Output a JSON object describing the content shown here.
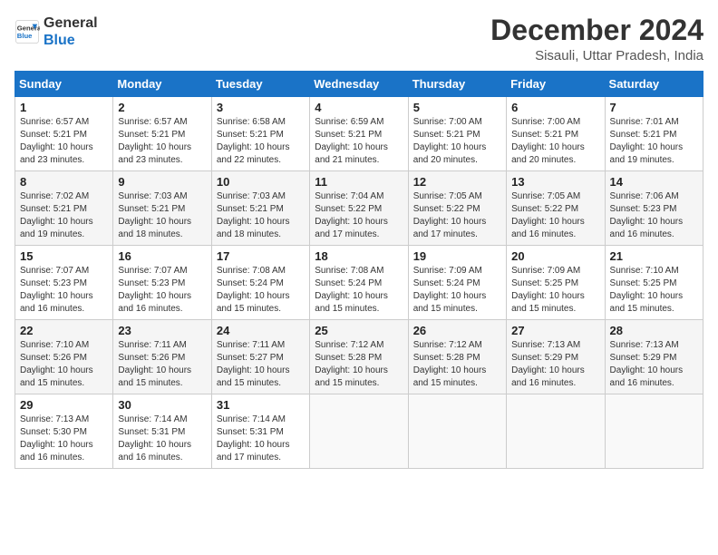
{
  "header": {
    "logo_line1": "General",
    "logo_line2": "Blue",
    "title": "December 2024",
    "subtitle": "Sisauli, Uttar Pradesh, India"
  },
  "weekdays": [
    "Sunday",
    "Monday",
    "Tuesday",
    "Wednesday",
    "Thursday",
    "Friday",
    "Saturday"
  ],
  "weeks": [
    [
      {
        "day": "1",
        "info": "Sunrise: 6:57 AM\nSunset: 5:21 PM\nDaylight: 10 hours\nand 23 minutes."
      },
      {
        "day": "2",
        "info": "Sunrise: 6:57 AM\nSunset: 5:21 PM\nDaylight: 10 hours\nand 23 minutes."
      },
      {
        "day": "3",
        "info": "Sunrise: 6:58 AM\nSunset: 5:21 PM\nDaylight: 10 hours\nand 22 minutes."
      },
      {
        "day": "4",
        "info": "Sunrise: 6:59 AM\nSunset: 5:21 PM\nDaylight: 10 hours\nand 21 minutes."
      },
      {
        "day": "5",
        "info": "Sunrise: 7:00 AM\nSunset: 5:21 PM\nDaylight: 10 hours\nand 20 minutes."
      },
      {
        "day": "6",
        "info": "Sunrise: 7:00 AM\nSunset: 5:21 PM\nDaylight: 10 hours\nand 20 minutes."
      },
      {
        "day": "7",
        "info": "Sunrise: 7:01 AM\nSunset: 5:21 PM\nDaylight: 10 hours\nand 19 minutes."
      }
    ],
    [
      {
        "day": "8",
        "info": "Sunrise: 7:02 AM\nSunset: 5:21 PM\nDaylight: 10 hours\nand 19 minutes."
      },
      {
        "day": "9",
        "info": "Sunrise: 7:03 AM\nSunset: 5:21 PM\nDaylight: 10 hours\nand 18 minutes."
      },
      {
        "day": "10",
        "info": "Sunrise: 7:03 AM\nSunset: 5:21 PM\nDaylight: 10 hours\nand 18 minutes."
      },
      {
        "day": "11",
        "info": "Sunrise: 7:04 AM\nSunset: 5:22 PM\nDaylight: 10 hours\nand 17 minutes."
      },
      {
        "day": "12",
        "info": "Sunrise: 7:05 AM\nSunset: 5:22 PM\nDaylight: 10 hours\nand 17 minutes."
      },
      {
        "day": "13",
        "info": "Sunrise: 7:05 AM\nSunset: 5:22 PM\nDaylight: 10 hours\nand 16 minutes."
      },
      {
        "day": "14",
        "info": "Sunrise: 7:06 AM\nSunset: 5:23 PM\nDaylight: 10 hours\nand 16 minutes."
      }
    ],
    [
      {
        "day": "15",
        "info": "Sunrise: 7:07 AM\nSunset: 5:23 PM\nDaylight: 10 hours\nand 16 minutes."
      },
      {
        "day": "16",
        "info": "Sunrise: 7:07 AM\nSunset: 5:23 PM\nDaylight: 10 hours\nand 16 minutes."
      },
      {
        "day": "17",
        "info": "Sunrise: 7:08 AM\nSunset: 5:24 PM\nDaylight: 10 hours\nand 15 minutes."
      },
      {
        "day": "18",
        "info": "Sunrise: 7:08 AM\nSunset: 5:24 PM\nDaylight: 10 hours\nand 15 minutes."
      },
      {
        "day": "19",
        "info": "Sunrise: 7:09 AM\nSunset: 5:24 PM\nDaylight: 10 hours\nand 15 minutes."
      },
      {
        "day": "20",
        "info": "Sunrise: 7:09 AM\nSunset: 5:25 PM\nDaylight: 10 hours\nand 15 minutes."
      },
      {
        "day": "21",
        "info": "Sunrise: 7:10 AM\nSunset: 5:25 PM\nDaylight: 10 hours\nand 15 minutes."
      }
    ],
    [
      {
        "day": "22",
        "info": "Sunrise: 7:10 AM\nSunset: 5:26 PM\nDaylight: 10 hours\nand 15 minutes."
      },
      {
        "day": "23",
        "info": "Sunrise: 7:11 AM\nSunset: 5:26 PM\nDaylight: 10 hours\nand 15 minutes."
      },
      {
        "day": "24",
        "info": "Sunrise: 7:11 AM\nSunset: 5:27 PM\nDaylight: 10 hours\nand 15 minutes."
      },
      {
        "day": "25",
        "info": "Sunrise: 7:12 AM\nSunset: 5:28 PM\nDaylight: 10 hours\nand 15 minutes."
      },
      {
        "day": "26",
        "info": "Sunrise: 7:12 AM\nSunset: 5:28 PM\nDaylight: 10 hours\nand 15 minutes."
      },
      {
        "day": "27",
        "info": "Sunrise: 7:13 AM\nSunset: 5:29 PM\nDaylight: 10 hours\nand 16 minutes."
      },
      {
        "day": "28",
        "info": "Sunrise: 7:13 AM\nSunset: 5:29 PM\nDaylight: 10 hours\nand 16 minutes."
      }
    ],
    [
      {
        "day": "29",
        "info": "Sunrise: 7:13 AM\nSunset: 5:30 PM\nDaylight: 10 hours\nand 16 minutes."
      },
      {
        "day": "30",
        "info": "Sunrise: 7:14 AM\nSunset: 5:31 PM\nDaylight: 10 hours\nand 16 minutes."
      },
      {
        "day": "31",
        "info": "Sunrise: 7:14 AM\nSunset: 5:31 PM\nDaylight: 10 hours\nand 17 minutes."
      },
      {
        "day": "",
        "info": ""
      },
      {
        "day": "",
        "info": ""
      },
      {
        "day": "",
        "info": ""
      },
      {
        "day": "",
        "info": ""
      }
    ]
  ]
}
